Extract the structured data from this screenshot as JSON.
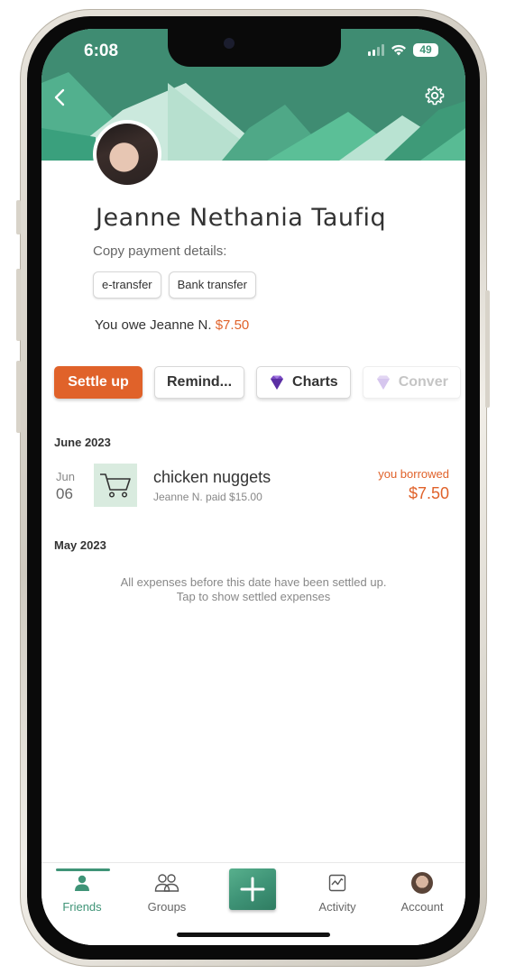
{
  "status_bar": {
    "time": "6:08",
    "battery": "49"
  },
  "profile": {
    "name": "Jeanne Nethania Taufiq",
    "copy_label": "Copy payment details:",
    "payment_chips": [
      "e-transfer",
      "Bank transfer"
    ],
    "owe_text": "You owe Jeanne N.",
    "owe_amount": "$7.50"
  },
  "actions": {
    "settle_up": "Settle up",
    "remind": "Remind...",
    "charts": "Charts",
    "convert": "Conver"
  },
  "sections": [
    {
      "month": "June 2023",
      "expenses": [
        {
          "month_abbr": "Jun",
          "day": "06",
          "title": "chicken nuggets",
          "subtitle": "Jeanne N. paid $15.00",
          "status_label": "you borrowed",
          "amount": "$7.50",
          "icon": "shopping-cart-icon"
        }
      ]
    },
    {
      "month": "May 2023",
      "settled_line1": "All expenses before this date have been settled up.",
      "settled_line2": "Tap to show settled expenses"
    }
  ],
  "tabbar": {
    "friends": "Friends",
    "groups": "Groups",
    "activity": "Activity",
    "account": "Account"
  },
  "colors": {
    "brand_green": "#3f9477",
    "accent_orange": "#e0622a"
  }
}
